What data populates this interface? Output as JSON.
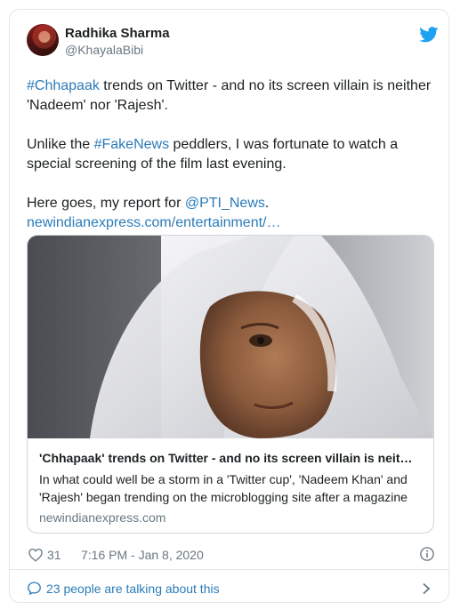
{
  "author": {
    "name": "Radhika Sharma",
    "handle": "@KhayalaBibi"
  },
  "tweet": {
    "p1": {
      "hashtag": "#Chhapaak",
      "rest": " trends on Twitter - and no its screen villain is neither 'Nadeem' nor 'Rajesh'."
    },
    "p2": {
      "pre": "Unlike the ",
      "hashtag": "#FakeNews",
      "rest": " peddlers, I was fortunate to watch a special screening of the film last evening."
    },
    "p3": {
      "pre": "Here goes, my report for ",
      "mention": "@PTI_News",
      "post": ".",
      "url": "newindianexpress.com/entertainment/…"
    }
  },
  "card": {
    "title": "'Chhapaak' trends on Twitter - and no its screen villain is neit…",
    "description": "In what could well be a storm in a 'Twitter cup', 'Nadeem Khan' and 'Rajesh' began trending on the microblogging site after a magazine",
    "domain": "newindianexpress.com"
  },
  "footer": {
    "likes": "31",
    "timestamp": "7:16 PM - Jan 8, 2020",
    "talking": "23 people are talking about this"
  },
  "icons": {
    "bird": "twitter-bird-icon",
    "heart": "heart-icon",
    "info": "info-icon",
    "bubble": "speech-bubble-icon",
    "chevron": "chevron-right-icon"
  },
  "colors": {
    "link": "#2b7bb9",
    "muted": "#697882",
    "text": "#1c2022",
    "twitter_blue": "#1da1f2"
  }
}
